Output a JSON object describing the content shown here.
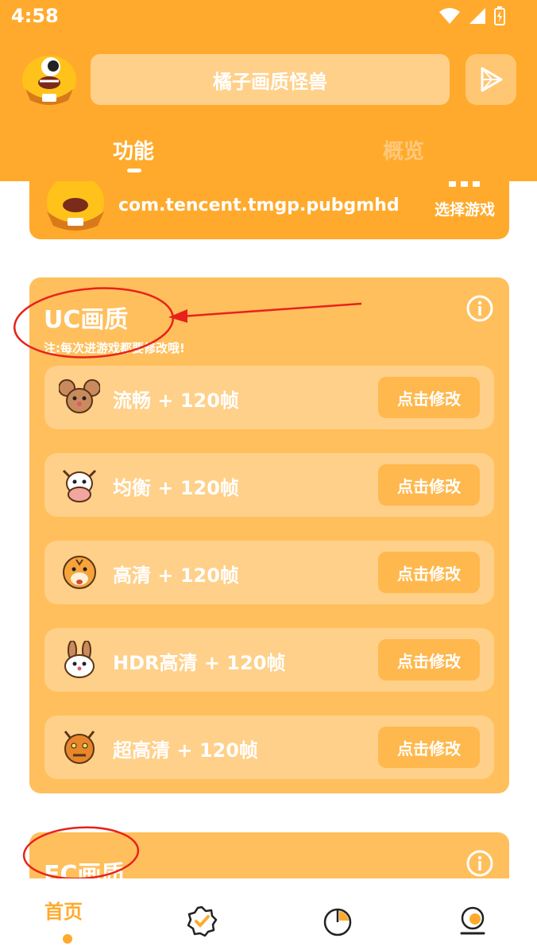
{
  "status": {
    "time": "4:58"
  },
  "header": {
    "title": "橘子画质怪兽"
  },
  "tabs": {
    "features": "功能",
    "overview": "概览"
  },
  "game": {
    "package": "com.tencent.tmgp.pubgmhd",
    "select_label": "选择游戏"
  },
  "uc_card": {
    "title": "UC画质",
    "note": "注:每次进游戏都要修改哦!",
    "items": [
      {
        "label": "流畅 + 120帧",
        "button": "点击修改",
        "icon": "mouse-icon"
      },
      {
        "label": "均衡 + 120帧",
        "button": "点击修改",
        "icon": "cow-icon"
      },
      {
        "label": "高清 + 120帧",
        "button": "点击修改",
        "icon": "tiger-icon"
      },
      {
        "label": "HDR高清 + 120帧",
        "button": "点击修改",
        "icon": "rabbit-icon"
      },
      {
        "label": "超高清 + 120帧",
        "button": "点击修改",
        "icon": "dragon-icon"
      }
    ]
  },
  "ec_card": {
    "title": "EC画质"
  },
  "nav": {
    "home": "首页"
  },
  "colors": {
    "brand": "#FFAA2C",
    "card": "#FFBF5C",
    "row": "#FFD089",
    "annotation": "#E8221B"
  }
}
